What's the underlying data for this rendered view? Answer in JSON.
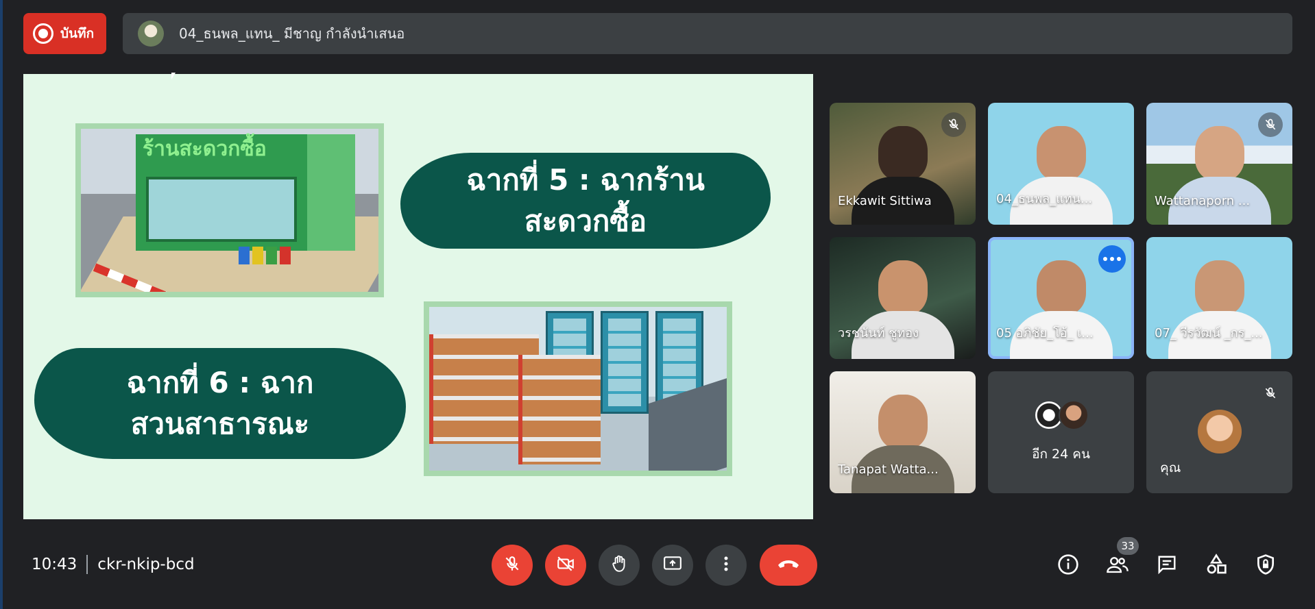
{
  "top_bar": {
    "record_label": "บันทึก",
    "presenter_text": "04_ธนพล_แทน_ มีชาญ กำลังนำเสนอ"
  },
  "slide": {
    "scene5_line1": "ฉากที่ 5 : ฉากร้าน",
    "scene5_line2": "สะดวกซื้อ",
    "scene6_line1": "ฉากที่ 6 : ฉาก",
    "scene6_line2": "สวนสาธารณะ",
    "store_sign": "ร้านสะดวกซื้อ"
  },
  "participants": [
    {
      "name": "Ekkawit Sittiwa",
      "muted": true
    },
    {
      "name": "04_ธนพล_แทน...",
      "muted": false
    },
    {
      "name": "Wattanaporn ...",
      "muted": true
    },
    {
      "name": "วรชนันท์ ชูทอง",
      "muted": false
    },
    {
      "name": "05 อภิชัย_โอ้_ เ...",
      "muted": false,
      "active": true
    },
    {
      "name": "07_ วีรวัฒน์ _กร_...",
      "muted": false
    },
    {
      "name": "Tanapat Watta...",
      "muted": false
    }
  ],
  "others_tile": {
    "label": "อีก 24 คน"
  },
  "you_tile": {
    "label": "คุณ",
    "muted": true
  },
  "bottom_bar": {
    "time": "10:43",
    "meeting_code": "ckr-nkip-bcd",
    "people_count": "33"
  },
  "colors": {
    "background": "#202124",
    "tile": "#3c4043",
    "danger": "#ea4335",
    "active_outline": "#8ab4f8",
    "slide_bg": "#e3f8e8",
    "scene_label": "#0b564a"
  },
  "icons": [
    "record-icon",
    "mic-off-icon",
    "camera-off-icon",
    "raise-hand-icon",
    "present-icon",
    "more-vert-icon",
    "hang-up-icon",
    "info-icon",
    "people-icon",
    "chat-icon",
    "activities-icon",
    "host-controls-icon"
  ]
}
